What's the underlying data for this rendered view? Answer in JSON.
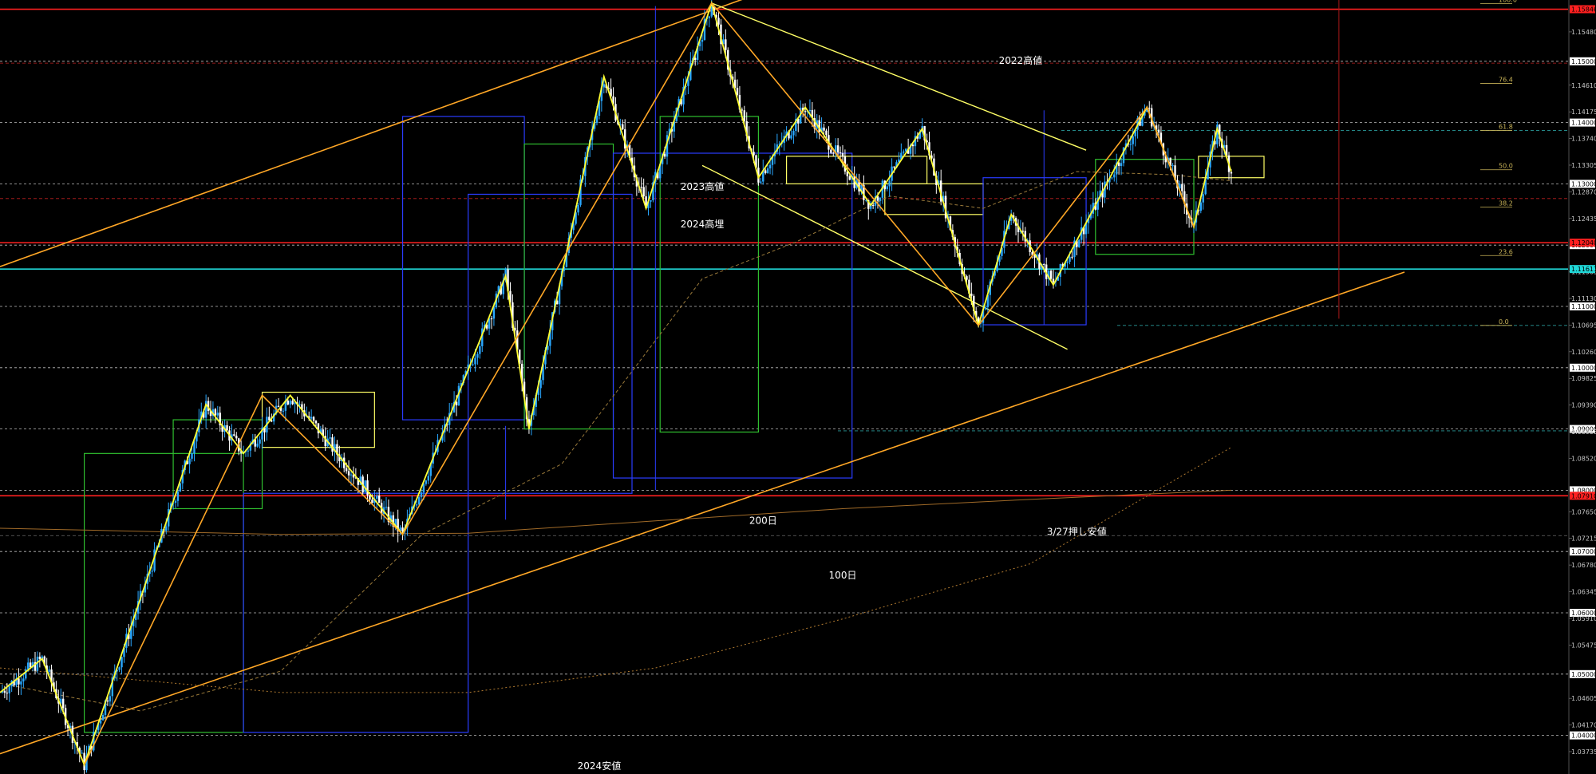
{
  "chart_data": {
    "type": "candlestick",
    "ylim": [
      1.0337,
      1.16
    ],
    "x_count": 300,
    "grid": false,
    "y_ticks": [
      {
        "value": 1.1548,
        "label": "1.15480",
        "style": "plain"
      },
      {
        "value": 1.15,
        "label": "1.15000",
        "style": "box"
      },
      {
        "value": 1.1461,
        "label": "1.14610",
        "style": "plain"
      },
      {
        "value": 1.14175,
        "label": "1.14175",
        "style": "plain"
      },
      {
        "value": 1.14,
        "label": "1.14000",
        "style": "box"
      },
      {
        "value": 1.1374,
        "label": "1.13740",
        "style": "plain"
      },
      {
        "value": 1.13305,
        "label": "1.13305",
        "style": "plain"
      },
      {
        "value": 1.13,
        "label": "1.13000",
        "style": "box"
      },
      {
        "value": 1.1287,
        "label": "1.12870",
        "style": "plain"
      },
      {
        "value": 1.12435,
        "label": "1.12435",
        "style": "plain"
      },
      {
        "value": 1.12,
        "label": "1.12000",
        "style": "box"
      },
      {
        "value": 1.11565,
        "label": "1.11565",
        "style": "plain"
      },
      {
        "value": 1.1113,
        "label": "1.11130",
        "style": "plain"
      },
      {
        "value": 1.11,
        "label": "1.11000",
        "style": "box"
      },
      {
        "value": 1.10695,
        "label": "1.10695",
        "style": "plain"
      },
      {
        "value": 1.1026,
        "label": "1.10260",
        "style": "plain"
      },
      {
        "value": 1.1,
        "label": "1.10000",
        "style": "box"
      },
      {
        "value": 1.09825,
        "label": "1.09825",
        "style": "plain"
      },
      {
        "value": 1.0939,
        "label": "1.09390",
        "style": "plain"
      },
      {
        "value": 1.09,
        "label": "1.09000",
        "style": "box"
      },
      {
        "value": 1.08955,
        "label": "1.08955",
        "style": "plain"
      },
      {
        "value": 1.0852,
        "label": "1.08520",
        "style": "plain"
      },
      {
        "value": 1.08,
        "label": "1.08000",
        "style": "box"
      },
      {
        "value": 1.0765,
        "label": "1.07650",
        "style": "plain"
      },
      {
        "value": 1.07215,
        "label": "1.07215",
        "style": "plain"
      },
      {
        "value": 1.07,
        "label": "1.07000",
        "style": "box"
      },
      {
        "value": 1.0678,
        "label": "1.06780",
        "style": "plain"
      },
      {
        "value": 1.06345,
        "label": "1.06345",
        "style": "plain"
      },
      {
        "value": 1.06,
        "label": "1.06000",
        "style": "box"
      },
      {
        "value": 1.0591,
        "label": "1.05910",
        "style": "plain"
      },
      {
        "value": 1.05475,
        "label": "1.05475",
        "style": "plain"
      },
      {
        "value": 1.05,
        "label": "1.05000",
        "style": "box"
      },
      {
        "value": 1.04605,
        "label": "1.04605",
        "style": "plain"
      },
      {
        "value": 1.0417,
        "label": "1.04170",
        "style": "plain"
      },
      {
        "value": 1.04,
        "label": "1.04000",
        "style": "box"
      },
      {
        "value": 1.03735,
        "label": "1.03735",
        "style": "plain"
      }
    ],
    "price_lines": [
      {
        "value": 1.1585,
        "color": "#ff2020",
        "label": "1.15846"
      },
      {
        "value": 1.1204,
        "color": "#ff2020",
        "label": "1.12040"
      },
      {
        "value": 1.0791,
        "color": "#ff2020",
        "label": "1.07910"
      },
      {
        "value": 1.0332,
        "color": "#ff2020",
        "label": ""
      },
      {
        "value": 1.1161,
        "color": "#20d8d8",
        "label": "1.11611"
      }
    ],
    "annotations": [
      {
        "text": "2022高値",
        "x": 218,
        "y": 1.1496
      },
      {
        "text": "2023高値",
        "x": 150,
        "y": 1.129
      },
      {
        "text": "2024高埋",
        "x": 150,
        "y": 1.1229
      },
      {
        "text": "200日",
        "x": 163,
        "y": 1.0745
      },
      {
        "text": "3/27押し安値",
        "x": 230,
        "y": 1.0727
      },
      {
        "text": "100日",
        "x": 180,
        "y": 1.0656
      },
      {
        "text": "2024安値",
        "x": 128,
        "y": 1.0345
      }
    ],
    "fib_levels": [
      {
        "label": "100.0",
        "value": 1.1594
      },
      {
        "label": "76.4",
        "value": 1.1464
      },
      {
        "label": "61.8",
        "value": 1.1387
      },
      {
        "label": "50.0",
        "value": 1.1323
      },
      {
        "label": "38.2",
        "value": 1.1262
      },
      {
        "label": "23.6",
        "value": 1.1183
      },
      {
        "label": "0.0",
        "value": 1.1069
      }
    ],
    "zigzag_waypoints": [
      [
        0,
        1.047
      ],
      [
        9,
        1.0525
      ],
      [
        18,
        1.0352
      ],
      [
        44,
        1.094
      ],
      [
        52,
        1.086
      ],
      [
        62,
        1.0955
      ],
      [
        86,
        1.0728
      ],
      [
        108,
        1.115
      ],
      [
        113,
        1.09
      ],
      [
        129,
        1.1475
      ],
      [
        138,
        1.126
      ],
      [
        152,
        1.1595
      ],
      [
        162,
        1.131
      ],
      [
        172,
        1.1425
      ],
      [
        186,
        1.1265
      ],
      [
        197,
        1.139
      ],
      [
        209,
        1.1069
      ],
      [
        216,
        1.125
      ],
      [
        225,
        1.1135
      ],
      [
        245,
        1.1425
      ],
      [
        255,
        1.123
      ],
      [
        260,
        1.139
      ],
      [
        263,
        1.132
      ]
    ],
    "ma_points": [
      [
        0,
        1.0485
      ],
      [
        30,
        1.044
      ],
      [
        60,
        1.0505
      ],
      [
        90,
        1.0727
      ],
      [
        120,
        1.0843
      ],
      [
        150,
        1.1145
      ],
      [
        170,
        1.1205
      ],
      [
        190,
        1.128
      ],
      [
        210,
        1.126
      ],
      [
        230,
        1.132
      ],
      [
        250,
        1.1315
      ],
      [
        263,
        1.1305
      ]
    ],
    "ma200_points": [
      [
        0,
        1.051
      ],
      [
        60,
        1.047
      ],
      [
        100,
        1.047
      ],
      [
        140,
        1.051
      ],
      [
        180,
        1.059
      ],
      [
        220,
        1.068
      ],
      [
        263,
        1.087
      ]
    ],
    "ma100_points": [
      [
        0,
        1.0738
      ],
      [
        60,
        1.0728
      ],
      [
        100,
        1.073
      ],
      [
        140,
        1.075
      ],
      [
        180,
        1.077
      ],
      [
        220,
        1.0785
      ],
      [
        263,
        1.08
      ]
    ]
  }
}
